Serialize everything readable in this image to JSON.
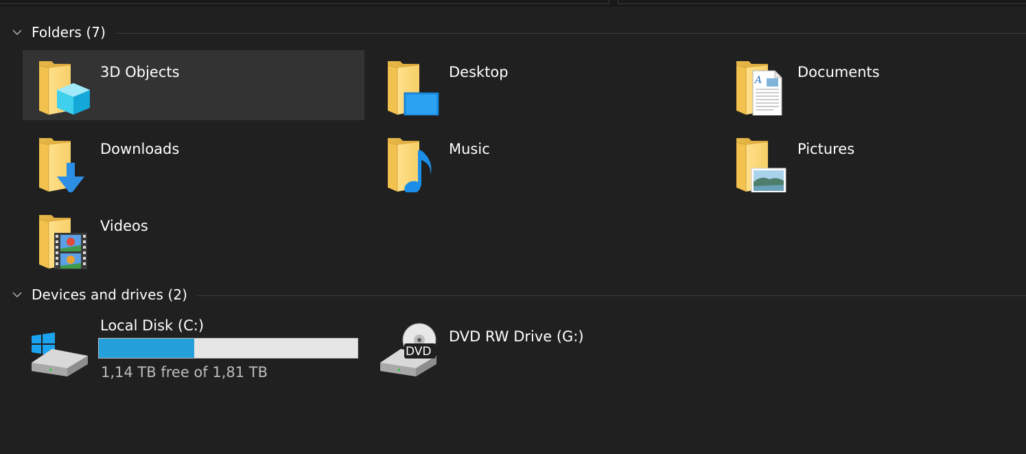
{
  "groups": {
    "folders": {
      "title": "Folders (7)",
      "items": [
        {
          "label": "3D Objects",
          "icon": "3d-objects-folder-icon",
          "selected": true
        },
        {
          "label": "Desktop",
          "icon": "desktop-folder-icon"
        },
        {
          "label": "Documents",
          "icon": "documents-folder-icon"
        },
        {
          "label": "Downloads",
          "icon": "downloads-folder-icon"
        },
        {
          "label": "Music",
          "icon": "music-folder-icon"
        },
        {
          "label": "Pictures",
          "icon": "pictures-folder-icon"
        },
        {
          "label": "Videos",
          "icon": "videos-folder-icon"
        }
      ]
    },
    "devices": {
      "title": "Devices and drives (2)",
      "items": [
        {
          "label": "Local Disk (C:)",
          "icon": "windows-drive-icon",
          "free_text": "1,14 TB free of 1,81 TB",
          "used_fraction": 0.37
        },
        {
          "label": "DVD RW Drive (G:)",
          "icon": "dvd-drive-icon",
          "badge": "DVD"
        }
      ]
    }
  },
  "colors": {
    "background": "#202020",
    "selected_tile": "#333333",
    "usage_bar_fill": "#26a0da",
    "usage_bar_track": "#e6e6e6"
  }
}
